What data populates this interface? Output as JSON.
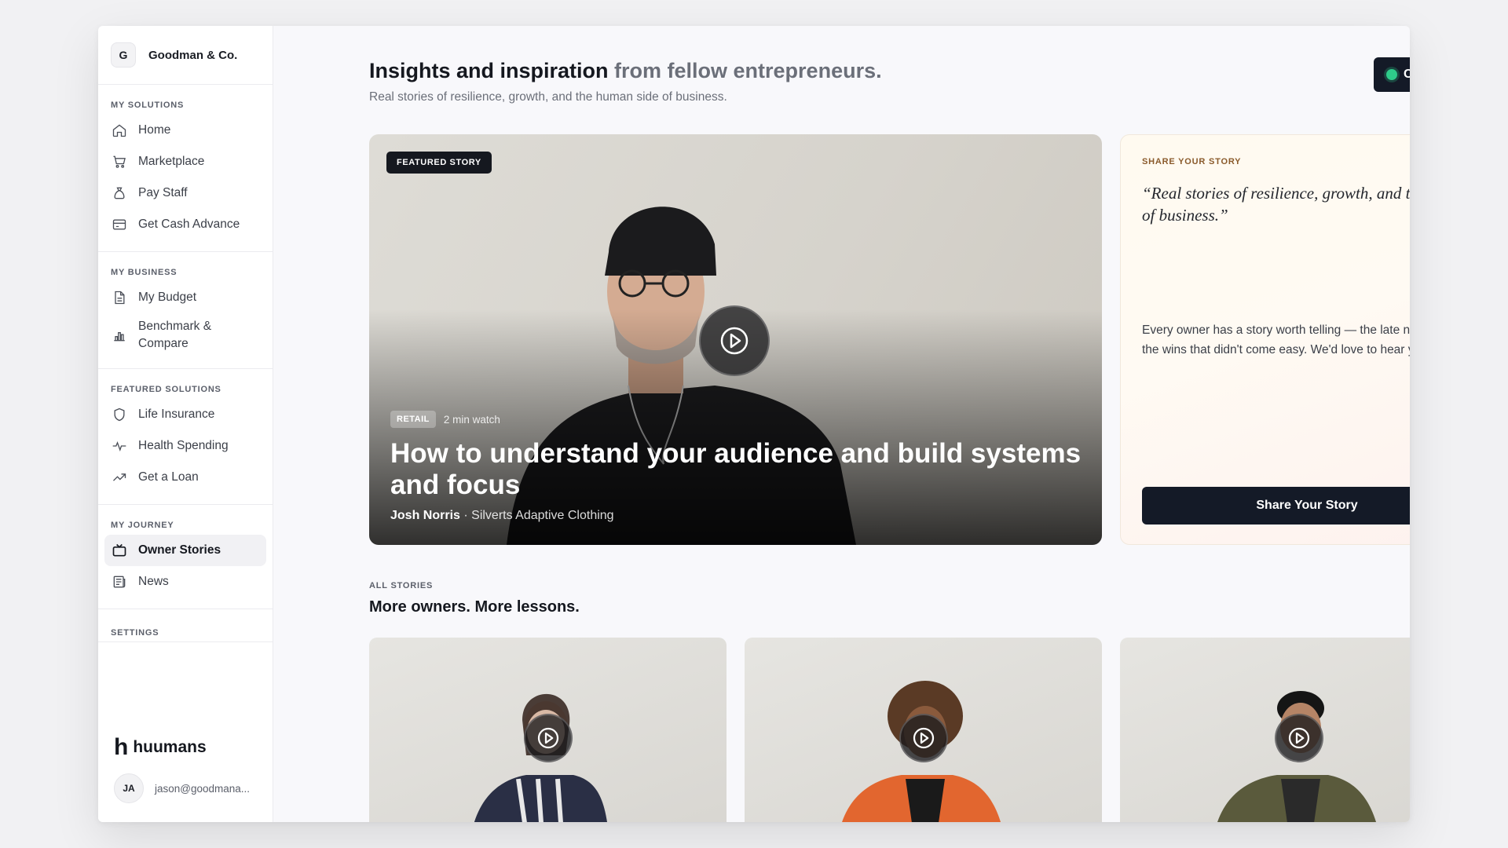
{
  "org": {
    "initial": "G",
    "name": "Goodman & Co."
  },
  "sidebar": {
    "sections": [
      {
        "title": "MY SOLUTIONS",
        "items": [
          {
            "label": "Home",
            "icon": "home-icon"
          },
          {
            "label": "Marketplace",
            "icon": "cart-icon"
          },
          {
            "label": "Pay Staff",
            "icon": "money-bag-icon"
          },
          {
            "label": "Get Cash Advance",
            "icon": "credit-card-icon"
          }
        ]
      },
      {
        "title": "MY BUSINESS",
        "items": [
          {
            "label": "My Budget",
            "icon": "document-icon"
          },
          {
            "label": "Benchmark & Compare",
            "icon": "bar-chart-icon"
          }
        ]
      },
      {
        "title": "FEATURED SOLUTIONS",
        "items": [
          {
            "label": "Life Insurance",
            "icon": "shield-icon"
          },
          {
            "label": "Health Spending",
            "icon": "pulse-icon"
          },
          {
            "label": "Get a Loan",
            "icon": "trending-up-icon"
          }
        ]
      },
      {
        "title": "MY JOURNEY",
        "items": [
          {
            "label": "Owner Stories",
            "icon": "tv-icon",
            "active": true
          },
          {
            "label": "News",
            "icon": "newspaper-icon"
          }
        ]
      }
    ],
    "settings_title": "SETTINGS"
  },
  "footer": {
    "brand_mark": "h",
    "brand": "huumans",
    "user_initials": "JA",
    "user_email": "jason@goodmana..."
  },
  "header": {
    "title_strong": "Insights and inspiration",
    "title_muted": "from fellow entrepreneurs.",
    "subtitle": "Real stories of resilience, growth, and the human side of business.",
    "contact_label": "Contact & Talk to"
  },
  "featured": {
    "badge": "FEATURED STORY",
    "category": "RETAIL",
    "duration": "2 min watch",
    "title": "How to understand your audience and build systems and focus",
    "author": "Josh Norris",
    "separator": " · ",
    "company": "Silverts Adaptive Clothing"
  },
  "share": {
    "kicker": "SHARE YOUR STORY",
    "quote": "“Real stories of resilience, growth, and the human side of business.”",
    "body": "Every owner has a story worth telling — the late nights, the lessons, the wins that didn't come easy. We'd love to hear yours.",
    "button": "Share Your Story"
  },
  "all_stories": {
    "kicker": "ALL STORIES",
    "title": "More owners. More lessons."
  },
  "colors": {
    "accent_dark": "#141a27",
    "status_green": "#2ecc8a",
    "share_kicker": "#8a5a2b"
  }
}
